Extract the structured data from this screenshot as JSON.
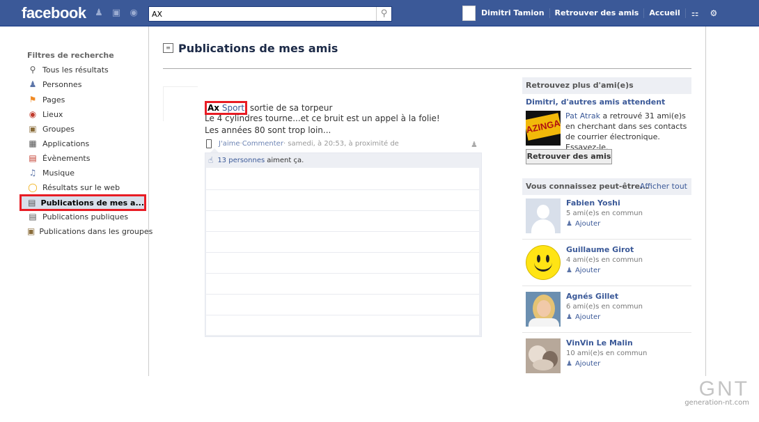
{
  "topbar": {
    "logo": "facebook",
    "search_value": "AX",
    "user_name": "Dimitri Tamion",
    "find_friends": "Retrouver des amis",
    "home": "Accueil"
  },
  "sidebar": {
    "title": "Filtres de recherche",
    "items": [
      {
        "label": "Tous les résultats",
        "icon": "magnifier-icon"
      },
      {
        "label": "Personnes",
        "icon": "person-icon"
      },
      {
        "label": "Pages",
        "icon": "flag-icon"
      },
      {
        "label": "Lieux",
        "icon": "map-pin-icon"
      },
      {
        "label": "Groupes",
        "icon": "group-icon"
      },
      {
        "label": "Applications",
        "icon": "applications-icon"
      },
      {
        "label": "Évènements",
        "icon": "calendar-icon"
      },
      {
        "label": "Musique",
        "icon": "music-icon"
      },
      {
        "label": "Résultats sur le web",
        "icon": "web-icon"
      },
      {
        "label": "Publications de mes a...",
        "icon": "feed-icon",
        "selected": true
      },
      {
        "label": "Publications publiques",
        "icon": "feed-icon"
      },
      {
        "label": "Publications dans les groupes",
        "icon": "group-feed-icon"
      }
    ]
  },
  "main": {
    "title": "Publications de mes amis",
    "post": {
      "author_bold": "Ax",
      "author_rest": " Sport",
      "line1_rest": " sortie de sa torpeur",
      "line2": "Le 4 cylindres tourne...et ce bruit est un appel à la folie!",
      "line3": "Les années 80 sont trop loin...",
      "like": "J'aime",
      "separator": " · ",
      "comment": "Commenter",
      "meta": " · samedi, à 20:53, à proximité de",
      "likes_count": "13 personnes",
      "likes_text": "aiment ça."
    }
  },
  "right": {
    "finder_header": "Retrouvez plus d'ami(e)s",
    "finder_title": "Dimitri, d'autres amis attendent",
    "finder_name": "Pat Atrak",
    "finder_text": " a retrouvé 31 ami(e)s en cherchant dans ses contacts de courrier électronique. Essayez-le.",
    "finder_logo": "AZINGA",
    "finder_button": "Retrouver des amis",
    "pymk_header": "Vous connaissez peut-être...",
    "see_all": "Afficher tout",
    "people": [
      {
        "name": "Fabien Yoshi",
        "mutual": "5 ami(e)s en commun",
        "add": "Ajouter"
      },
      {
        "name": "Guillaume Girot",
        "mutual": "4 ami(e)s en commun",
        "add": "Ajouter"
      },
      {
        "name": "Agnés Gillet",
        "mutual": "6 ami(e)s en commun",
        "add": "Ajouter"
      },
      {
        "name": "VinVin Le Malin",
        "mutual": "10 ami(e)s en commun",
        "add": "Ajouter"
      }
    ]
  },
  "watermark": {
    "brand": "GNT",
    "url": "generation-nt.com"
  }
}
